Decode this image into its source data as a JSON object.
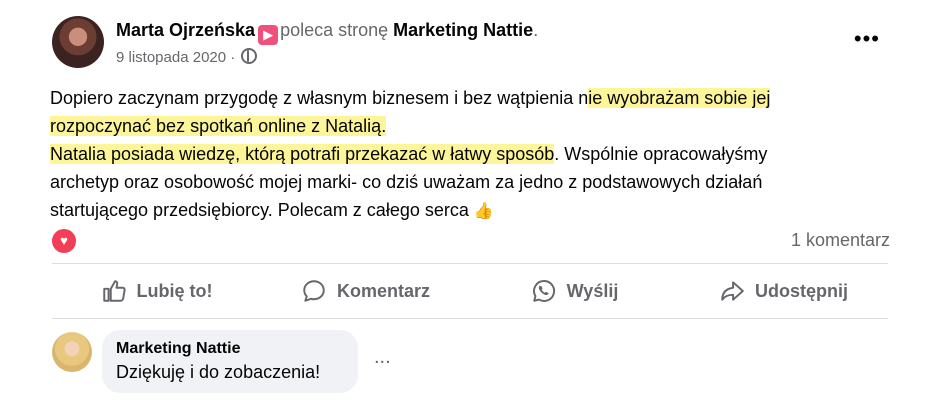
{
  "post": {
    "author": "Marta Ojrzeńska",
    "badge_icon": "recommend-icon",
    "verb": "poleca stronę",
    "page": "Marketing Nattie",
    "date": "9 listopada 2020 ·",
    "privacy_icon": "globe-icon",
    "more": "•••",
    "text": {
      "line1_plain": "Dopiero zaczynam przygodę z własnym biznesem i bez wątpienia n",
      "line1_hl": "ie wyobrażam sobie jej",
      "line2_hl": "rozpoczynać bez spotkań online z Natalią.",
      "line3_hl": "Natalia posiada wiedzę, którą potrafi przekazać w łatwy sposób",
      "line3_plain": ". Wspólnie opracowałyśmy",
      "line4": "archetyp oraz osobowość mojej marki- co dziś uważam za jedno z podstawowych działań",
      "line5": "startującego przedsiębiorcy.  Polecam z całego serca",
      "emoji": "👍"
    },
    "reaction_icon": "heart-reaction-icon",
    "comments_count": "1 komentarz"
  },
  "actions": [
    {
      "label": "Lubię to!",
      "icon": "like-icon"
    },
    {
      "label": "Komentarz",
      "icon": "comment-icon"
    },
    {
      "label": "Wyślij",
      "icon": "whatsapp-icon"
    },
    {
      "label": "Udostępnij",
      "icon": "share-icon"
    }
  ],
  "comment": {
    "author": "Marketing Nattie",
    "text": "Dziękuję i do zobaczenia!",
    "more": "..."
  },
  "colors": {
    "highlight": "#fcf59a",
    "reaction": "#f33e58",
    "secondary_text": "#65676b",
    "bubble": "#f0f2f5"
  }
}
